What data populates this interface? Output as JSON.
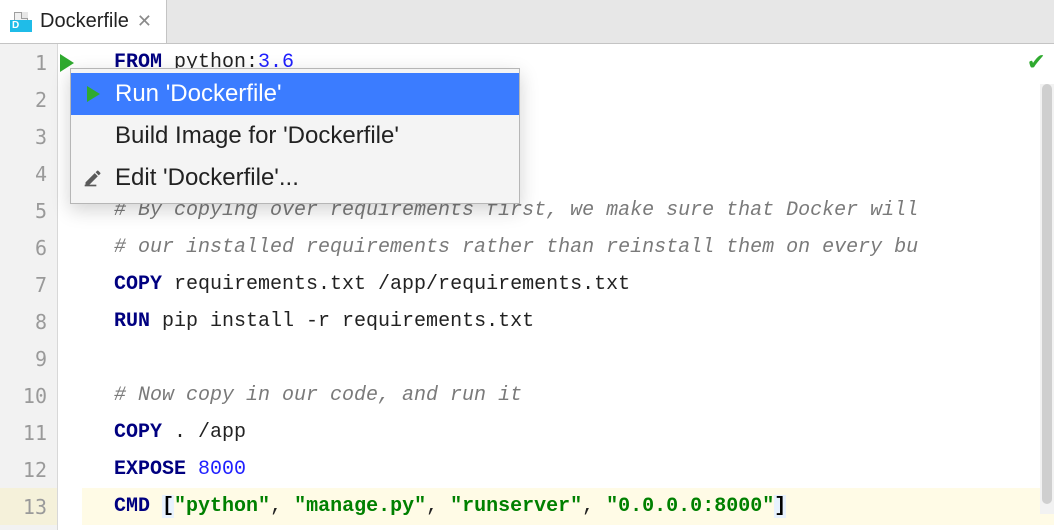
{
  "tab": {
    "title": "Dockerfile",
    "icon_letter": "D"
  },
  "context_menu": {
    "items": [
      {
        "label": "Run 'Dockerfile'",
        "icon": "run",
        "selected": true
      },
      {
        "label": "Build Image for 'Dockerfile'",
        "icon": "",
        "selected": false
      },
      {
        "label": "Edit 'Dockerfile'...",
        "icon": "edit",
        "selected": false
      }
    ]
  },
  "gutter": {
    "run_icon_line": 1,
    "validation": "ok"
  },
  "code": {
    "lines": [
      {
        "n": 1,
        "segments": [
          {
            "t": "FROM",
            "c": "kw"
          },
          {
            "t": " python:",
            "c": "plain"
          },
          {
            "t": "3.6",
            "c": "num"
          }
        ]
      },
      {
        "n": 2,
        "segments": []
      },
      {
        "n": 3,
        "segments": []
      },
      {
        "n": 4,
        "segments": []
      },
      {
        "n": 5,
        "segments": [
          {
            "t": "# By copying over requirements first, we make sure that Docker will",
            "c": "comment"
          }
        ]
      },
      {
        "n": 6,
        "segments": [
          {
            "t": "# our installed requirements rather than reinstall them on every bu",
            "c": "comment"
          }
        ]
      },
      {
        "n": 7,
        "segments": [
          {
            "t": "COPY",
            "c": "kw"
          },
          {
            "t": " requirements.txt /app/requirements.txt",
            "c": "plain"
          }
        ]
      },
      {
        "n": 8,
        "segments": [
          {
            "t": "RUN",
            "c": "kw"
          },
          {
            "t": " pip install -r requirements.txt",
            "c": "plain"
          }
        ]
      },
      {
        "n": 9,
        "segments": []
      },
      {
        "n": 10,
        "segments": [
          {
            "t": "# Now copy in our code, and run it",
            "c": "comment"
          }
        ]
      },
      {
        "n": 11,
        "segments": [
          {
            "t": "COPY",
            "c": "kw"
          },
          {
            "t": " . /app",
            "c": "plain"
          }
        ]
      },
      {
        "n": 12,
        "segments": [
          {
            "t": "EXPOSE",
            "c": "kw"
          },
          {
            "t": " ",
            "c": "plain"
          },
          {
            "t": "8000",
            "c": "num"
          }
        ]
      },
      {
        "n": 13,
        "current": true,
        "segments": [
          {
            "t": "CMD",
            "c": "kw"
          },
          {
            "t": " ",
            "c": "plain"
          },
          {
            "t": "[",
            "c": "bracket cursor-bracket"
          },
          {
            "t": "\"python\"",
            "c": "str"
          },
          {
            "t": ", ",
            "c": "plain"
          },
          {
            "t": "\"manage.py\"",
            "c": "str"
          },
          {
            "t": ", ",
            "c": "plain"
          },
          {
            "t": "\"runserver\"",
            "c": "str"
          },
          {
            "t": ", ",
            "c": "plain"
          },
          {
            "t": "\"0.0.0.0:8000\"",
            "c": "str"
          },
          {
            "t": "]",
            "c": "bracket cursor-bracket"
          }
        ]
      }
    ]
  }
}
